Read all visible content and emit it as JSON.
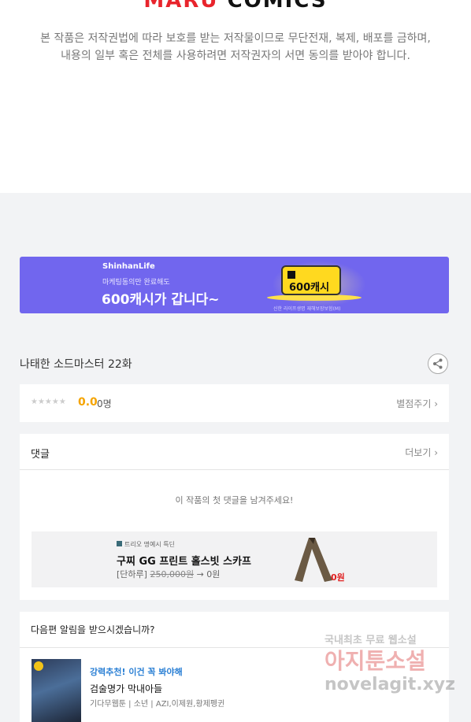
{
  "header": {
    "logo_part1": "MARU",
    "logo_part2": "COMICS",
    "notice_line1": "본 작품은 저작권법에 따라 보호를 받는 저작물이므로 무단전재, 복제, 배포를 금하며,",
    "notice_line2": "내용의 일부 혹은 전체를 사용하려면 저작권자의 서면 동의를 받아야 합니다."
  },
  "banner": {
    "brand": "ShinhanLife",
    "sub": "마케팅동의만 완료해도",
    "headline": "600캐시가 갑니다~",
    "cash_label": "600캐시",
    "fine_print": "신한 라이프생명 재해보장보험(M)",
    "bg_color": "#7166ee"
  },
  "episode": {
    "title": "나태한 소드마스터 22화",
    "share_icon": "share-icon"
  },
  "rating": {
    "stars": "★★★★★",
    "score": "0.0",
    "count": "0명",
    "rate_link": "별점주기 ›"
  },
  "comments": {
    "header": "댓글",
    "more": "더보기 ›",
    "empty_message": "이 작품의 첫 댓글을 남겨주세요!",
    "ad": {
      "tag": "트리오 명예시 특딘",
      "name": "구찌 GG 프린트 홀스빗 스카프",
      "price_prefix": "[단하루]",
      "price_original": "250,000원",
      "price_arrow": "→ 0원",
      "price_badge": "0원"
    }
  },
  "alert": {
    "question": "다음편 알림을 받으시겠습니까?",
    "rec_label": "강력추천! 이건 꼭 봐야해",
    "rec_title": "검술명가 막내아들",
    "rec_meta": "기다무웹툰 | 소년 | AZI,이제원,황제펭귄"
  },
  "watermark": {
    "line1": "국내최초 무료 웹소설",
    "line2": "아지툰소설",
    "line3": "novelagit.xyz"
  }
}
